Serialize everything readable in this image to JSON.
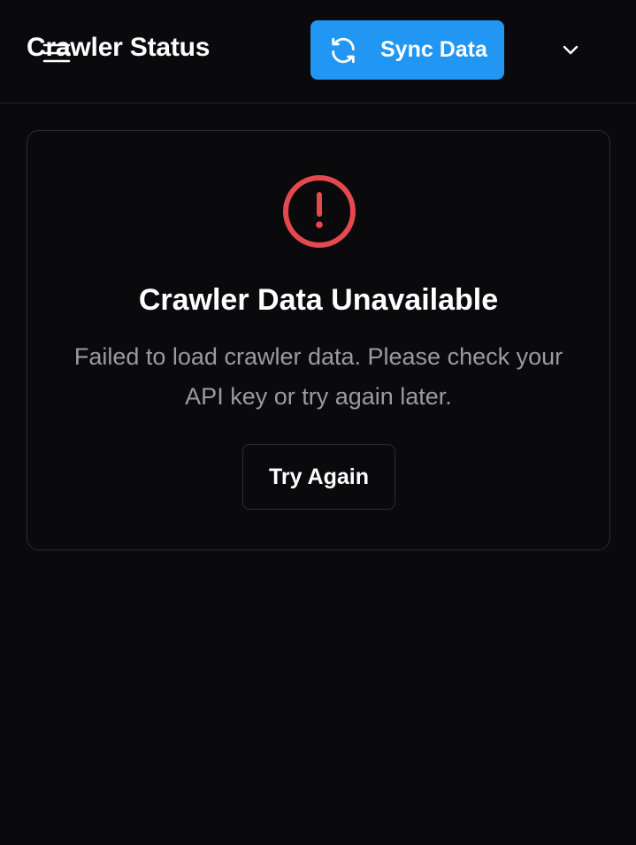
{
  "header": {
    "title": "Crawler Status",
    "sync_label": "Sync Data",
    "menu_icon": "menu-icon",
    "sync_icon": "refresh-icon",
    "chevron_icon": "chevron-down-icon"
  },
  "error_card": {
    "icon": "alert-circle-icon",
    "title": "Crawler Data Unavailable",
    "message": "Failed to load crawler data. Please check your API key or try again later.",
    "retry_label": "Try Again"
  },
  "colors": {
    "background": "#0a0a0c",
    "accent": "#2196f3",
    "error": "#e5484d",
    "muted_text": "#9a9aa3",
    "border": "#2c2c32"
  }
}
